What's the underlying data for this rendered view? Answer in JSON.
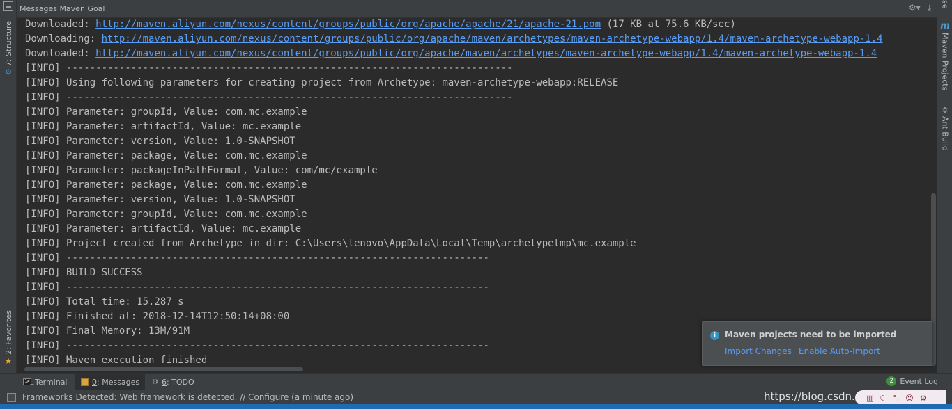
{
  "window": {
    "panel_title": "Messages Maven Goal"
  },
  "left_tabs": {
    "structure": "7: Structure",
    "favorites": "2: Favorites"
  },
  "right_tabs": {
    "se": "se",
    "maven_projects": "Maven Projects",
    "ant_build": "Ant Build"
  },
  "console": {
    "lines": [
      {
        "prefix": "Downloaded: ",
        "link": "http://maven.aliyun.com/nexus/content/groups/public/org/apache/apache/21/apache-21.pom",
        "suffix": " (17 KB at 75.6 KB/sec)"
      },
      {
        "prefix": "Downloading: ",
        "link": "http://maven.aliyun.com/nexus/content/groups/public/org/apache/maven/archetypes/maven-archetype-webapp/1.4/maven-archetype-webapp-1.4",
        "suffix": ""
      },
      {
        "prefix": "Downloaded: ",
        "link": "http://maven.aliyun.com/nexus/content/groups/public/org/apache/maven/archetypes/maven-archetype-webapp/1.4/maven-archetype-webapp-1.4",
        "suffix": ""
      },
      {
        "text": "[INFO] ----------------------------------------------------------------------------"
      },
      {
        "text": "[INFO] Using following parameters for creating project from Archetype: maven-archetype-webapp:RELEASE"
      },
      {
        "text": "[INFO] ----------------------------------------------------------------------------"
      },
      {
        "text": "[INFO] Parameter: groupId, Value: com.mc.example"
      },
      {
        "text": "[INFO] Parameter: artifactId, Value: mc.example"
      },
      {
        "text": "[INFO] Parameter: version, Value: 1.0-SNAPSHOT"
      },
      {
        "text": "[INFO] Parameter: package, Value: com.mc.example"
      },
      {
        "text": "[INFO] Parameter: packageInPathFormat, Value: com/mc/example"
      },
      {
        "text": "[INFO] Parameter: package, Value: com.mc.example"
      },
      {
        "text": "[INFO] Parameter: version, Value: 1.0-SNAPSHOT"
      },
      {
        "text": "[INFO] Parameter: groupId, Value: com.mc.example"
      },
      {
        "text": "[INFO] Parameter: artifactId, Value: mc.example"
      },
      {
        "text": "[INFO] Project created from Archetype in dir: C:\\Users\\lenovo\\AppData\\Local\\Temp\\archetypetmp\\mc.example"
      },
      {
        "text": "[INFO] ------------------------------------------------------------------------"
      },
      {
        "text": "[INFO] BUILD SUCCESS"
      },
      {
        "text": "[INFO] ------------------------------------------------------------------------"
      },
      {
        "text": "[INFO] Total time: 15.287 s"
      },
      {
        "text": "[INFO] Finished at: 2018-12-14T12:50:14+08:00"
      },
      {
        "text": "[INFO] Final Memory: 13M/91M"
      },
      {
        "text": "[INFO] ------------------------------------------------------------------------"
      },
      {
        "text": "[INFO] Maven execution finished"
      }
    ]
  },
  "notification": {
    "title": "Maven projects need to be imported",
    "import_changes": "Import Changes",
    "enable_auto_import": "Enable Auto-Import"
  },
  "bottom_tabs": {
    "terminal": "Terminal",
    "messages_num": "0",
    "messages_rest": ": Messages",
    "todo_num": "6",
    "todo_rest": ": TODO",
    "event_log": "Event Log",
    "event_count": "2"
  },
  "status": {
    "text": "Frameworks Detected: Web framework is detected. // Configure (a minute ago)",
    "watermark": "https://blog.csdn.net/"
  },
  "colors": {
    "background": "#2b2b2b",
    "link": "#589df6",
    "panel": "#3c3f41"
  }
}
